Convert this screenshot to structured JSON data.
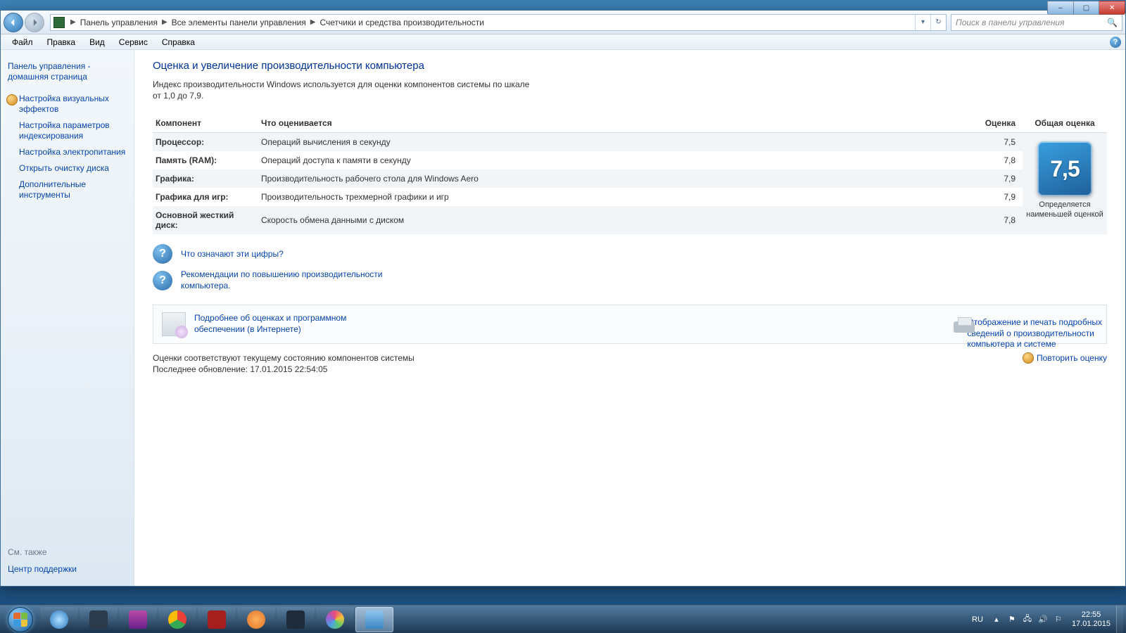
{
  "window_controls": {
    "min": "–",
    "max": "▢",
    "close": "✕"
  },
  "breadcrumb": {
    "items": [
      "Панель управления",
      "Все элементы панели управления",
      "Счетчики и средства производительности"
    ]
  },
  "nav_buttons": {
    "dropdown": "▾",
    "refresh": "↻"
  },
  "search": {
    "placeholder": "Поиск в панели управления"
  },
  "menubar": [
    "Файл",
    "Правка",
    "Вид",
    "Сервис",
    "Справка"
  ],
  "sidebar": {
    "home": "Панель управления - домашняя страница",
    "links": [
      "Настройка визуальных эффектов",
      "Настройка параметров индексирования",
      "Настройка электропитания",
      "Открыть очистку диска",
      "Дополнительные инструменты"
    ],
    "see_also_label": "См. также",
    "see_also_link": "Центр поддержки"
  },
  "main": {
    "title": "Оценка и увеличение производительности компьютера",
    "intro": "Индекс производительности Windows используется для оценки компонентов системы по шкале от 1,0 до 7,9.",
    "columns": {
      "c1": "Компонент",
      "c2": "Что оценивается",
      "c3": "Оценка",
      "c4": "Общая оценка"
    },
    "rows": [
      {
        "comp": "Процессор:",
        "desc": "Операций вычисления в секунду",
        "score": "7,5"
      },
      {
        "comp": "Память (RAM):",
        "desc": "Операций доступа к памяти в секунду",
        "score": "7,8"
      },
      {
        "comp": "Графика:",
        "desc": "Производительность рабочего стола для Windows Aero",
        "score": "7,9"
      },
      {
        "comp": "Графика для игр:",
        "desc": "Производительность трехмерной графики и игр",
        "score": "7,9"
      },
      {
        "comp": "Основной жесткий диск:",
        "desc": "Скорость обмена данными с диском",
        "score": "7,8"
      }
    ],
    "base_score": "7,5",
    "base_caption": "Определяется наименьшей оценкой",
    "help_links": [
      "Что означают эти цифры?",
      "Рекомендации по повышению производительности компьютера."
    ],
    "print_link": "Отображение и печать подробных сведений о производительности компьютера и системе",
    "software_link": "Подробнее об оценках и программном обеспечении (в Интернете)",
    "status_line1": "Оценки соответствуют текущему состоянию компонентов системы",
    "status_line2": "Последнее обновление: 17.01.2015 22:54:05",
    "rerun": "Повторить оценку"
  },
  "taskbar": {
    "lang": "RU",
    "time": "22:55",
    "date": "17.01.2015"
  }
}
